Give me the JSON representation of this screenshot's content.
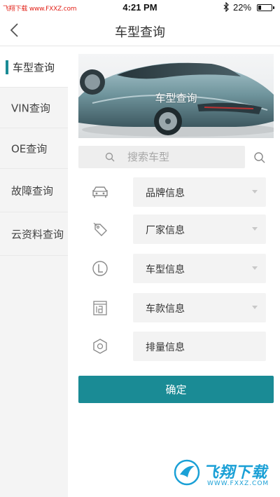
{
  "status_bar": {
    "watermark": "飞翔下载 www.FXXZ.com",
    "time": "4:21 PM",
    "battery_percent": "22%",
    "battery_level": 0.22
  },
  "nav": {
    "title": "车型查询",
    "back_icon": "chevron-left-icon"
  },
  "sidebar": {
    "items": [
      {
        "label": "车型查询",
        "active": true
      },
      {
        "label": "VIN查询",
        "active": false
      },
      {
        "label": "OE查询",
        "active": false
      },
      {
        "label": "故障查询",
        "active": false
      },
      {
        "label": "云资料查询",
        "active": false
      }
    ]
  },
  "banner": {
    "caption": "车型查询"
  },
  "search": {
    "placeholder": "搜索车型",
    "value": ""
  },
  "filters": [
    {
      "label": "品牌信息",
      "icon": "car-icon",
      "has_dropdown": true
    },
    {
      "label": "厂家信息",
      "icon": "tag-icon",
      "has_dropdown": true
    },
    {
      "label": "车型信息",
      "icon": "letter-l-icon",
      "has_dropdown": true
    },
    {
      "label": "车款信息",
      "icon": "calendar-icon",
      "has_dropdown": true
    },
    {
      "label": "排量信息",
      "icon": "hexagon-icon",
      "has_dropdown": false
    }
  ],
  "confirm": {
    "label": "确定"
  },
  "watermark": {
    "brand": "飞翔下载",
    "url": "WWW.FXXZ.COM"
  },
  "colors": {
    "accent": "#1a8b95",
    "sidebar_bg": "#f4f4f4",
    "field_bg": "#f3f3f3"
  }
}
